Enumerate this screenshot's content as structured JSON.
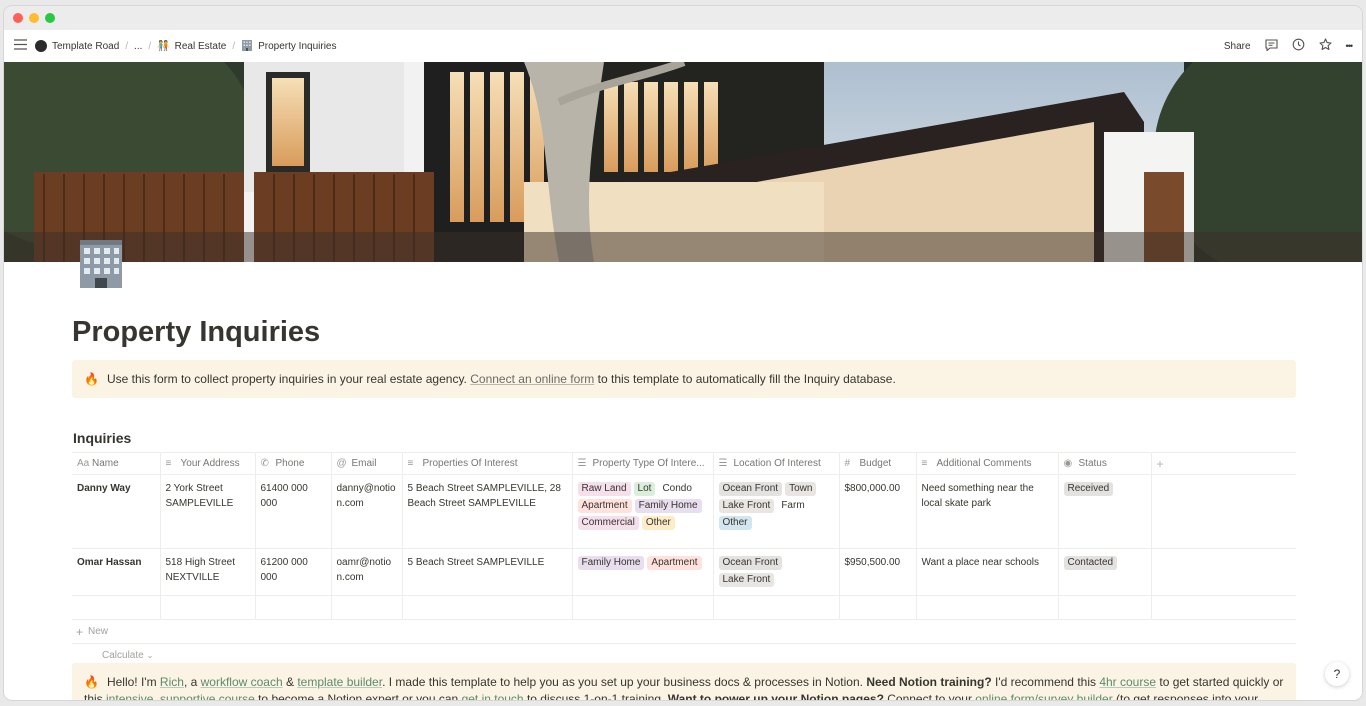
{
  "window": {
    "traffic_lights": {
      "close": "#fe5f57",
      "minimize": "#febc2e",
      "maximize": "#28c840"
    }
  },
  "breadcrumb": {
    "items": [
      {
        "label": "Template Road",
        "icon": "avatar-icon"
      },
      {
        "label": "..."
      },
      {
        "label": "Real Estate",
        "icon": "people-emoji-icon"
      },
      {
        "label": "Property Inquiries",
        "icon": "office-building-icon"
      }
    ],
    "separator": "/"
  },
  "topbar": {
    "share_label": "Share",
    "more_label": "•••"
  },
  "page": {
    "icon": "office-building-icon",
    "title": "Property Inquiries"
  },
  "callout1": {
    "icon": "🔥",
    "text_before": "Use this form to collect property inquiries in your real estate agency. ",
    "link": "Connect an online form",
    "text_after": " to this template to automatically fill the Inquiry database."
  },
  "database": {
    "title": "Inquiries",
    "columns": [
      {
        "label": "Name",
        "icon": "Aa"
      },
      {
        "label": "Your Address",
        "icon": "≡"
      },
      {
        "label": "Phone",
        "icon": "✆"
      },
      {
        "label": "Email",
        "icon": "@"
      },
      {
        "label": "Properties Of Interest",
        "icon": "≡"
      },
      {
        "label": "Property Type Of Intere...",
        "icon": "☰"
      },
      {
        "label": "Location Of Interest",
        "icon": "☰"
      },
      {
        "label": "Budget",
        "icon": "#"
      },
      {
        "label": "Additional Comments",
        "icon": "≡"
      },
      {
        "label": "Status",
        "icon": "◉"
      }
    ],
    "add_column": "+",
    "rows": [
      {
        "name": "Danny Way",
        "address": "2 York Street SAMPLEVILLE",
        "phone": "61400 000 000",
        "email": "danny@notion.com",
        "properties": "5 Beach Street SAMPLEVILLE, 28 Beach Street SAMPLEVILLE",
        "property_types": [
          {
            "label": "Raw Land",
            "color": "#f4dfeb"
          },
          {
            "label": "Lot",
            "color": "#dbeddb"
          },
          {
            "label": "Condo",
            "color": "#ffffff"
          },
          {
            "label": "Apartment",
            "color": "#ffe2dd"
          },
          {
            "label": "Family Home",
            "color": "#e8deee"
          },
          {
            "label": "Commercial",
            "color": "#f4dfeb"
          },
          {
            "label": "Other",
            "color": "#fdecc8"
          }
        ],
        "locations": [
          {
            "label": "Ocean Front",
            "color": "#e3e2e0"
          },
          {
            "label": "Town",
            "color": "#e9e5e3"
          },
          {
            "label": "Lake Front",
            "color": "#e9e5e3"
          },
          {
            "label": "Farm",
            "color": "#ffffff"
          },
          {
            "label": "Other",
            "color": "#d3e5ef"
          }
        ],
        "budget": "$800,000.00",
        "comments": "Need something near the local skate park",
        "status": {
          "label": "Received",
          "color": "#e3e2e0"
        }
      },
      {
        "name": "Omar Hassan",
        "address": "518 High Street NEXTVILLE",
        "phone": "61200 000 000",
        "email": "oamr@notion.com",
        "properties": "5 Beach Street SAMPLEVILLE",
        "property_types": [
          {
            "label": "Family Home",
            "color": "#e8deee"
          },
          {
            "label": "Apartment",
            "color": "#ffe2dd"
          }
        ],
        "locations": [
          {
            "label": "Ocean Front",
            "color": "#e3e2e0"
          },
          {
            "label": "Lake Front",
            "color": "#e9e5e3"
          }
        ],
        "budget": "$950,500.00",
        "comments": "Want a place near schools",
        "status": {
          "label": "Contacted",
          "color": "#e3e2e0"
        }
      }
    ],
    "new_label": "New",
    "calculate_label": "Calculate"
  },
  "callout2": {
    "icon": "🔥",
    "hello": "Hello! I'm ",
    "rich": "Rich",
    "a": ", a ",
    "workflow_coach": "workflow coach",
    "amp": " & ",
    "template_builder": "template builder",
    "t1": ". I made this template to help you as you set up your business docs & processes in Notion. ",
    "bold1": "Need Notion training?",
    "t2": " I'd recommend this ",
    "course": "4hr course",
    "t3": " to get started quickly or this ",
    "intensive": "intensive, supportive course",
    "t4": " to become a Notion expert or you can ",
    "touch": "get in touch",
    "t5": " to discuss 1-on-1 training. ",
    "bold2": "Want to power up your Notion pages?",
    "t6": " Connect to your ",
    "form": "online form/survey builder",
    "t7": " (to get responses into your database)"
  },
  "help_label": "?"
}
